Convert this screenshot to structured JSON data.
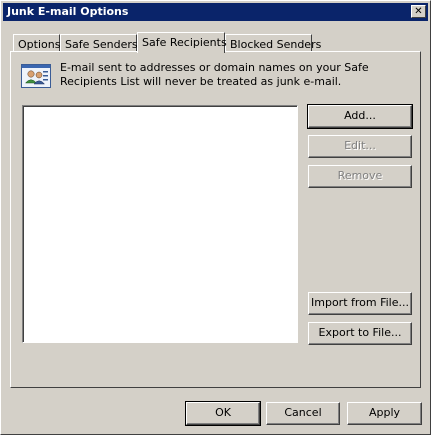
{
  "window": {
    "title": "Junk E-mail Options",
    "close_glyph": "✕"
  },
  "tabs": [
    {
      "label": "Options"
    },
    {
      "label": "Safe Senders"
    },
    {
      "label": "Safe Recipients",
      "active": true
    },
    {
      "label": "Blocked Senders"
    }
  ],
  "panel": {
    "icon": "contacts-list-icon",
    "description": "E-mail sent to addresses or domain names on your Safe Recipients List will never be treated as junk e-mail.",
    "list_items": [],
    "buttons": {
      "add": "Add...",
      "edit": "Edit...",
      "remove": "Remove",
      "import": "Import from File...",
      "export": "Export to File..."
    }
  },
  "footer": {
    "ok": "OK",
    "cancel": "Cancel",
    "apply": "Apply"
  }
}
